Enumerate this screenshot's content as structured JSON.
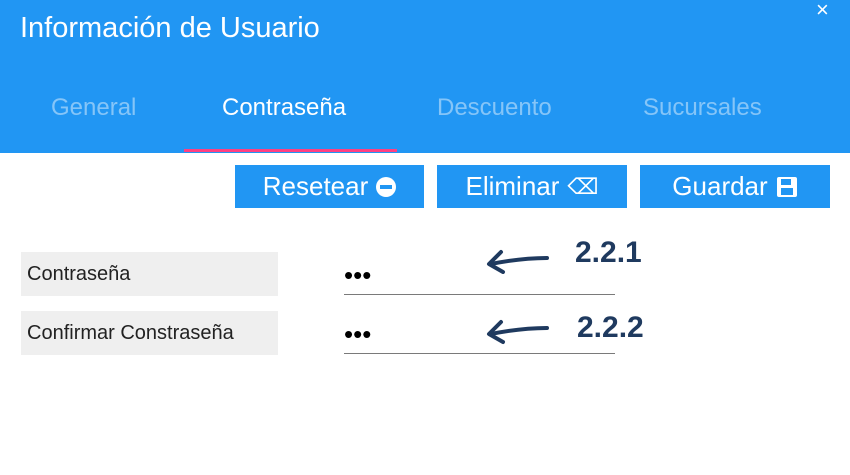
{
  "window": {
    "title": "Información de Usuario",
    "close_glyph": "×"
  },
  "tabs": [
    {
      "label": "General",
      "active": false
    },
    {
      "label": "Contraseña",
      "active": true
    },
    {
      "label": "Descuento",
      "active": false
    },
    {
      "label": "Sucursales",
      "active": false
    }
  ],
  "toolbar": {
    "reset_label": "Resetear",
    "reset_icon": "minus-circle-icon",
    "delete_label": "Eliminar",
    "delete_icon": "backspace-icon",
    "delete_glyph": "⌫",
    "save_label": "Guardar",
    "save_icon": "floppy-disk-icon",
    "save_glyph": "🖫"
  },
  "form": {
    "password_label": "Contraseña",
    "password_value": "•••",
    "confirm_label": "Confirmar Constraseña",
    "confirm_value": "•••"
  },
  "annotations": {
    "first": "2.2.1",
    "second": "2.2.2"
  },
  "colors": {
    "primary": "#2196f3",
    "tab_indicator": "#ff4081",
    "annotation": "#1f3a5f"
  }
}
